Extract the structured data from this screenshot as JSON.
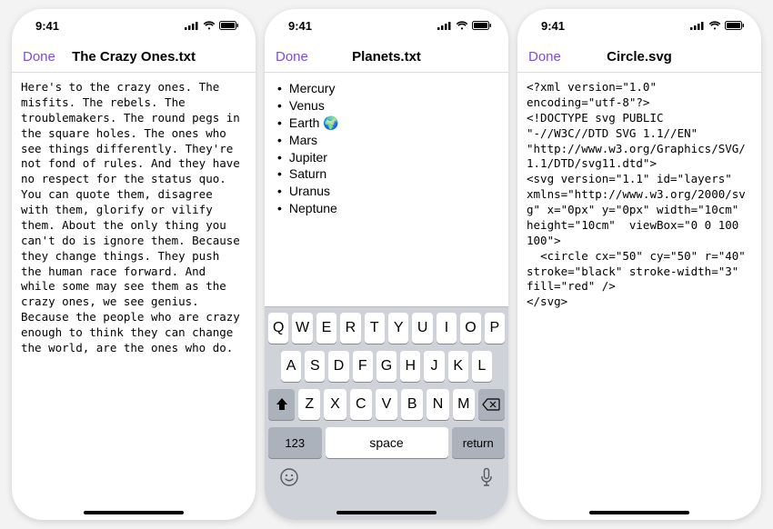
{
  "status": {
    "time": "9:41"
  },
  "nav": {
    "done": "Done"
  },
  "screens": [
    {
      "title": "The Crazy Ones.txt",
      "type": "text",
      "body": "Here's to the crazy ones. The misfits. The rebels. The troublemakers. The round pegs in the square holes. The ones who see things differently. They're not fond of rules. And they have no respect for the status quo. You can quote them, disagree with them, glorify or vilify them. About the only thing you can't do is ignore them. Because they change things. They push the human race forward. And while some may see them as the crazy ones, we see genius. Because the people who are crazy enough to think they can change the world, are the ones who do."
    },
    {
      "title": "Planets.txt",
      "type": "list",
      "items": [
        "Mercury",
        "Venus",
        "Earth 🌍",
        "Mars",
        "Jupiter",
        "Saturn",
        "Uranus",
        "Neptune"
      ]
    },
    {
      "title": "Circle.svg",
      "type": "code",
      "body": "<?xml version=\"1.0\" encoding=\"utf-8\"?>\n<!DOCTYPE svg PUBLIC \"-//W3C//DTD SVG 1.1//EN\" \"http://www.w3.org/Graphics/SVG/1.1/DTD/svg11.dtd\">\n<svg version=\"1.1\" id=\"layers\" xmlns=\"http://www.w3.org/2000/svg\" x=\"0px\" y=\"0px\" width=\"10cm\" height=\"10cm\"  viewBox=\"0 0 100 100\">\n  <circle cx=\"50\" cy=\"50\" r=\"40\" stroke=\"black\" stroke-width=\"3\" fill=\"red\" />\n</svg>"
    }
  ],
  "keyboard": {
    "row1": [
      "Q",
      "W",
      "E",
      "R",
      "T",
      "Y",
      "U",
      "I",
      "O",
      "P"
    ],
    "row2": [
      "A",
      "S",
      "D",
      "F",
      "G",
      "H",
      "J",
      "K",
      "L"
    ],
    "row3": [
      "Z",
      "X",
      "C",
      "V",
      "B",
      "N",
      "M"
    ],
    "shift": "⇧",
    "delete": "⌫",
    "numbers": "123",
    "space": "space",
    "return": "return",
    "emoji": "😊",
    "mic": "🎤"
  }
}
